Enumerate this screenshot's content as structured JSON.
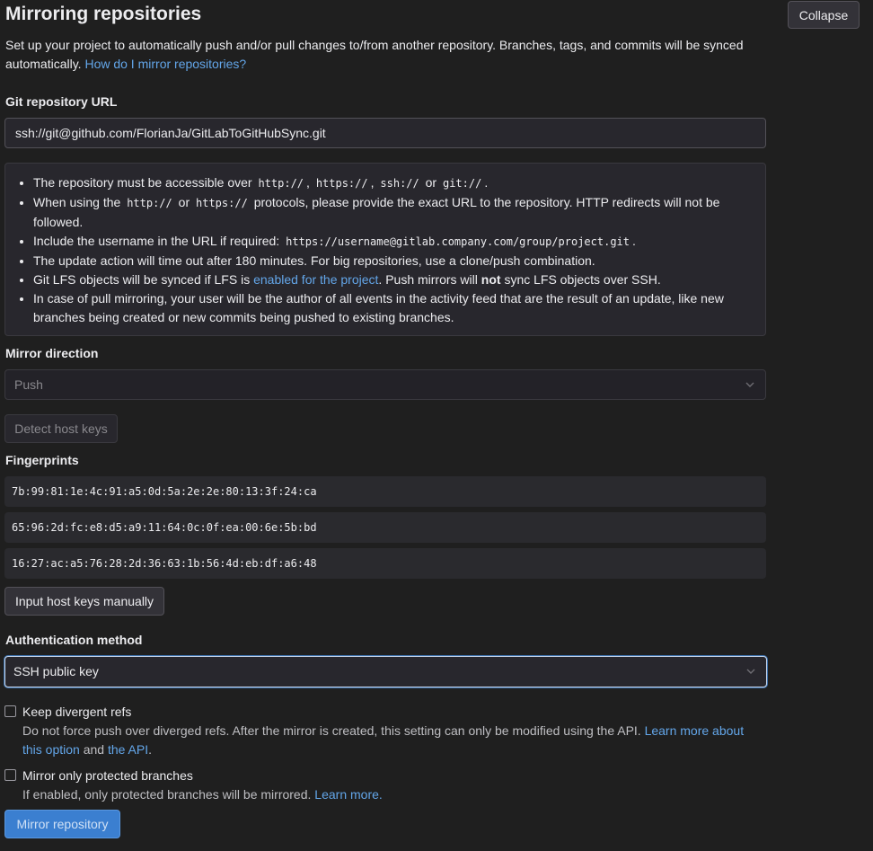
{
  "header": {
    "title": "Mirroring repositories",
    "collapse_label": "Collapse"
  },
  "intro": {
    "text": "Set up your project to automatically push and/or pull changes to/from another repository. Branches, tags, and commits will be synced automatically.",
    "link": "How do I mirror repositories?"
  },
  "git_url": {
    "label": "Git repository URL",
    "value": "ssh://git@github.com/FlorianJa/GitLabToGitHubSync.git"
  },
  "help": {
    "item1_pre": "The repository must be accessible over",
    "item1_c1": "http://",
    "item1_c2": "https://",
    "item1_c3": "ssh://",
    "item1_or": "or",
    "item1_c4": "git://",
    "item2_pre": "When using the",
    "item2_c1": "http://",
    "item2_or": "or",
    "item2_c2": "https://",
    "item2_post": "protocols, please provide the exact URL to the repository. HTTP redirects will not be followed.",
    "item3_pre": "Include the username in the URL if required:",
    "item3_code": "https://username@gitlab.company.com/group/project.git",
    "item4": "The update action will time out after 180 minutes. For big repositories, use a clone/push combination.",
    "item5_pre": "Git LFS objects will be synced if LFS is",
    "item5_link": "enabled for the project",
    "item5_mid": ". Push mirrors will",
    "item5_bold": "not",
    "item5_post": "sync LFS objects over SSH.",
    "item6": "In case of pull mirroring, your user will be the author of all events in the activity feed that are the result of an update, like new branches being created or new commits being pushed to existing branches."
  },
  "mirror_direction": {
    "label": "Mirror direction",
    "value": "Push"
  },
  "detect_host_keys_label": "Detect host keys",
  "fingerprints": {
    "label": "Fingerprints",
    "items": [
      "7b:99:81:1e:4c:91:a5:0d:5a:2e:2e:80:13:3f:24:ca",
      "65:96:2d:fc:e8:d5:a9:11:64:0c:0f:ea:00:6e:5b:bd",
      "16:27:ac:a5:76:28:2d:36:63:1b:56:4d:eb:df:a6:48"
    ]
  },
  "input_host_keys_label": "Input host keys manually",
  "auth": {
    "label": "Authentication method",
    "value": "SSH public key"
  },
  "keep_divergent": {
    "label": "Keep divergent refs",
    "help": "Do not force push over diverged refs. After the mirror is created, this setting can only be modified using the API.",
    "link1": "Learn more about this option",
    "and": "and",
    "link2": "the API",
    "end": "."
  },
  "protected_only": {
    "label": "Mirror only protected branches",
    "help": "If enabled, only protected branches will be mirrored.",
    "link": "Learn more."
  },
  "submit_label": "Mirror repository"
}
